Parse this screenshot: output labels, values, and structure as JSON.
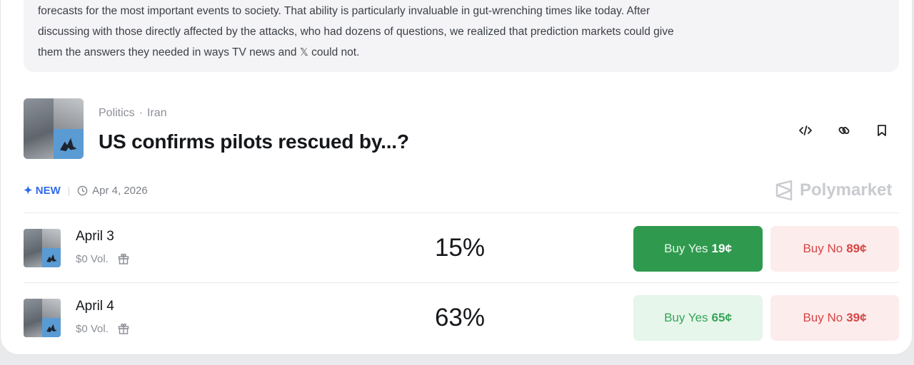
{
  "quote": {
    "line1": "forecasts for the most important events to society. That ability is particularly invaluable in gut-wrenching times like today. After",
    "line2": "discussing with those directly affected by the attacks, who had dozens of questions, we realized that prediction markets could give",
    "line3a": "them the answers they needed in ways TV news and ",
    "x_glyph": "𝕏",
    "line3b": " could not."
  },
  "market": {
    "category": "Politics",
    "breadcrumb_separator": "·",
    "subcategory": "Iran",
    "title": "US confirms pilots rescued by...?",
    "badge": "✦ NEW",
    "date": "Apr 4, 2026",
    "brand": "Polymarket",
    "actions": [
      "embed-icon",
      "link-icon",
      "bookmark-icon"
    ]
  },
  "outcomes": [
    {
      "name": "April 3",
      "volume": "$0 Vol.",
      "probability": "15%",
      "buy_yes_label": "Buy Yes",
      "buy_yes_price": "19¢",
      "buy_no_label": "Buy No",
      "buy_no_price": "89¢"
    },
    {
      "name": "April 4",
      "volume": "$0 Vol.",
      "probability": "63%",
      "buy_yes_label": "Buy Yes",
      "buy_yes_price": "65¢",
      "buy_no_label": "Buy No",
      "buy_no_price": "39¢"
    }
  ],
  "colors": {
    "accent_blue": "#2f6bea",
    "yes_green": "#2f9a4e",
    "no_red": "#d64545"
  }
}
